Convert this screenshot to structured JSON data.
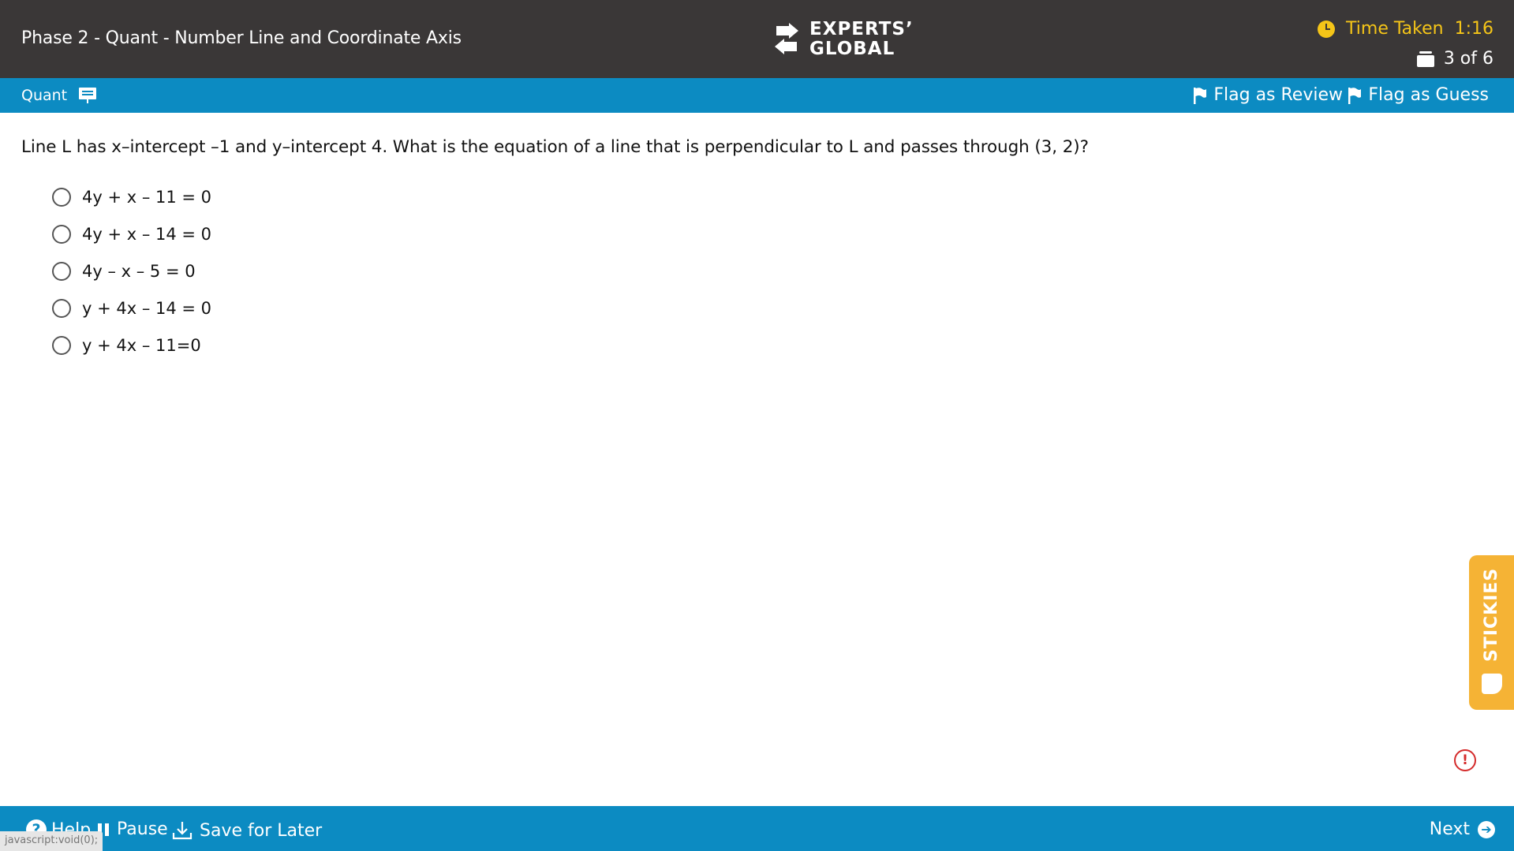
{
  "header": {
    "title": "Phase 2 - Quant - Number Line and Coordinate Axis",
    "logo_line1": "EXPERTS’",
    "logo_line2": "GLOBAL",
    "time_label": "Time Taken",
    "time_value": "1:16",
    "question_counter": "3 of 6",
    "colors": {
      "background": "#3a3737",
      "timer": "#f5c518"
    }
  },
  "section_bar": {
    "section": "Quant",
    "flag_review": "Flag as Review",
    "flag_guess": "Flag as Guess",
    "color": "#0c8bc2"
  },
  "question": {
    "text": "Line L has x–intercept –1 and y–intercept 4. What is the equation of a line that is perpendicular to L and passes through (3, 2)?",
    "options": [
      "4y + x – 11 = 0",
      "4y + x – 14 = 0",
      "4y – x – 5 = 0",
      "y + 4x – 14 = 0",
      "y + 4x – 11=0"
    ]
  },
  "stickies": {
    "label": "STICKIES",
    "color": "#f5b335"
  },
  "alert": {
    "symbol": "!",
    "color": "#d42b2b"
  },
  "footer": {
    "help": "Help",
    "help_icon": "?",
    "pause": "Pause",
    "save": "Save for Later",
    "next": "Next",
    "next_icon": "➔"
  },
  "status_url": "javascript:void(0);"
}
